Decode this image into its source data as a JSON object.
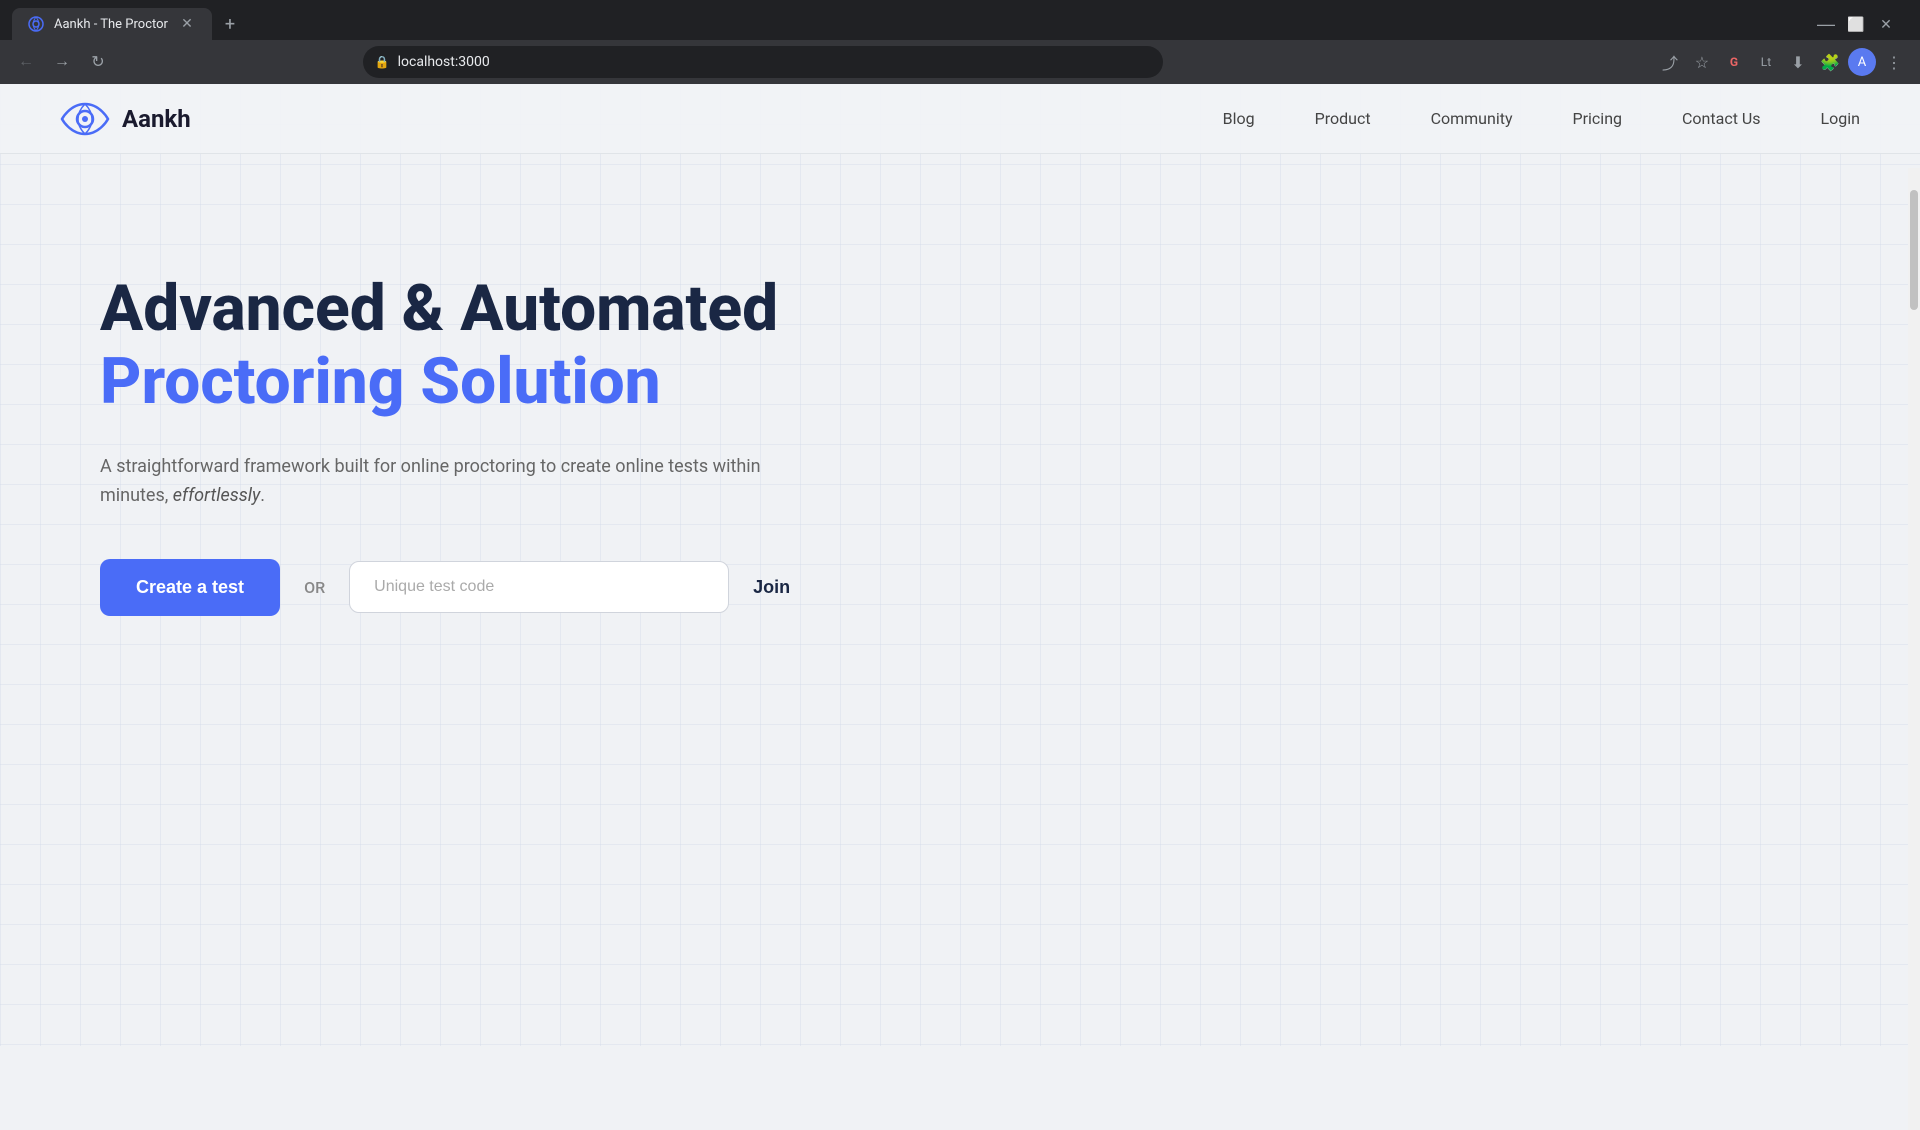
{
  "browser": {
    "tab_title": "Aankh - The Proctor",
    "tab_favicon": "👁",
    "url": "localhost:3000",
    "new_tab_label": "+"
  },
  "navbar": {
    "logo_text": "Aankh",
    "nav_items": [
      {
        "id": "blog",
        "label": "Blog"
      },
      {
        "id": "product",
        "label": "Product"
      },
      {
        "id": "community",
        "label": "Community"
      },
      {
        "id": "pricing",
        "label": "Pricing"
      },
      {
        "id": "contact",
        "label": "Contact Us"
      },
      {
        "id": "login",
        "label": "Login"
      }
    ]
  },
  "hero": {
    "title_line1": "Advanced & Automated",
    "title_line2": "Proctoring Solution",
    "description_part1": "A straightforward framework built for online proctoring to create online tests within minutes, ",
    "description_italic": "effortlessly",
    "description_end": ".",
    "cta_button": "Create a test",
    "or_text": "OR",
    "input_placeholder": "Unique test code",
    "join_button": "Join"
  }
}
